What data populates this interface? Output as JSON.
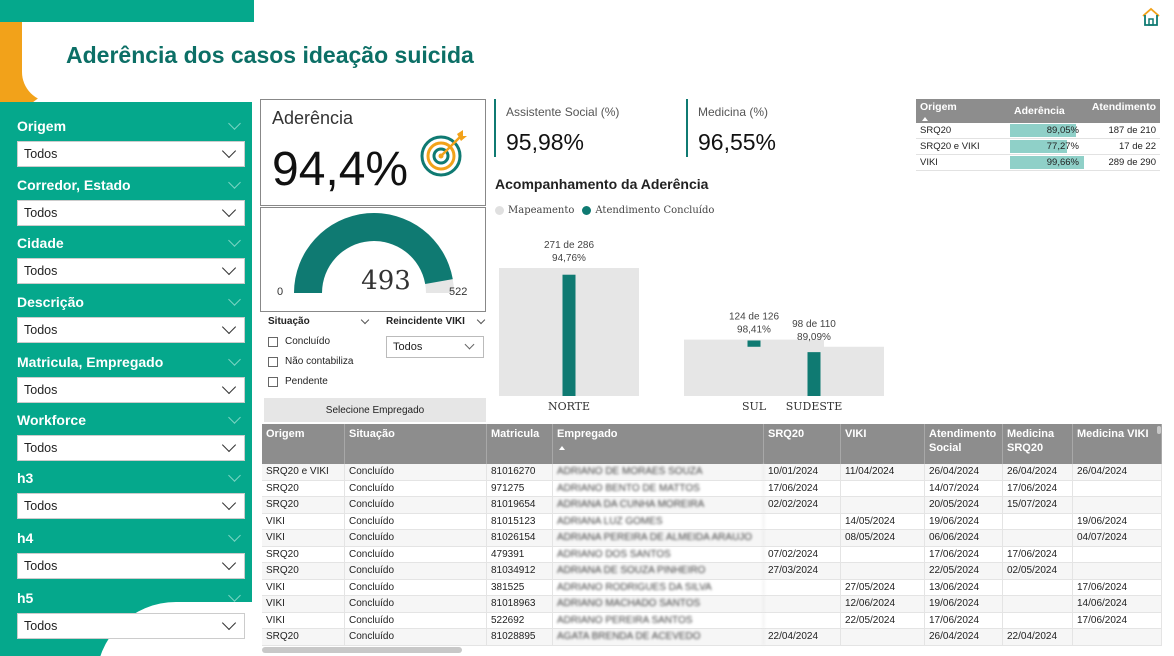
{
  "page": {
    "title": "Aderência dos casos ideação suicida"
  },
  "colors": {
    "teal": "#05a88c",
    "dark_teal": "#0f7a72",
    "orange": "#f2a21a",
    "grey_bar": "#e6e6e6"
  },
  "filters": [
    {
      "label": "Origem",
      "value": "Todos"
    },
    {
      "label": "Corredor, Estado",
      "value": "Todos"
    },
    {
      "label": "Cidade",
      "value": "Todos"
    },
    {
      "label": "Descrição",
      "value": "Todos"
    },
    {
      "label": "Matricula, Empregado",
      "value": "Todos"
    },
    {
      "label": "Workforce",
      "value": "Todos"
    },
    {
      "label": "h3",
      "value": "Todos"
    },
    {
      "label": "h4",
      "value": "Todos"
    },
    {
      "label": "h5",
      "value": "Todos"
    }
  ],
  "kpi_main": {
    "label": "Aderência",
    "value": "94,4%",
    "icon": "target-icon"
  },
  "gauge": {
    "value": "493",
    "min": "0",
    "max": "522",
    "value_num": 493,
    "max_num": 522
  },
  "slicer_situacao": {
    "title": "Situação",
    "options": [
      "Concluído",
      "Não contabiliza",
      "Pendente"
    ]
  },
  "slicer_reincidente": {
    "title": "Reincidente VIKI",
    "value": "Todos"
  },
  "select_employee_label": "Selecione Empregado",
  "kpi_cards": [
    {
      "label": "Assistente Social (%)",
      "value": "95,98%"
    },
    {
      "label": "Medicina (%)",
      "value": "96,55%"
    }
  ],
  "origin_table": {
    "headers": [
      "Origem",
      "Aderência",
      "Atendimento"
    ],
    "rows": [
      {
        "origem": "SRQ20",
        "aderencia": "89,05%",
        "aderencia_num": 0.8905,
        "atendimento": "187 de 210"
      },
      {
        "origem": "SRQ20 e VIKI",
        "aderencia": "77,27%",
        "aderencia_num": 0.7727,
        "atendimento": "17 de 22"
      },
      {
        "origem": "VIKI",
        "aderencia": "99,66%",
        "aderencia_num": 0.9966,
        "atendimento": "289 de 290"
      }
    ]
  },
  "chart_title": "Acompanhamento da Aderência",
  "chart_data": {
    "type": "bar",
    "legend": [
      "Mapeamento",
      "Atendimento Concluído"
    ],
    "categories": [
      "NORTE",
      "SUL",
      "SUDESTE"
    ],
    "series": [
      {
        "name": "Mapeamento",
        "values": [
          286,
          126,
          110
        ]
      },
      {
        "name": "Atendimento Concluído",
        "values": [
          271,
          124,
          98
        ]
      }
    ],
    "labels": [
      {
        "count": "271 de 286",
        "pct": "94,76%"
      },
      {
        "count": "124 de 126",
        "pct": "98,41%"
      },
      {
        "count": "98 de 110",
        "pct": "89,09%"
      }
    ]
  },
  "main_table": {
    "headers": [
      "Origem",
      "Situação",
      "Matricula",
      "Empregado",
      "SRQ20",
      "VIKI",
      "Atendimento Social",
      "Medicina SRQ20",
      "Medicina VIKI"
    ],
    "rows": [
      [
        "SRQ20 e VIKI",
        "Concluído",
        "81016270",
        "ADRIANO DE MORAES SOUZA",
        "10/01/2024",
        "11/04/2024",
        "26/04/2024",
        "26/04/2024",
        "26/04/2024"
      ],
      [
        "SRQ20",
        "Concluído",
        "971275",
        "ADRIANO BENTO DE MATTOS",
        "17/06/2024",
        "",
        "14/07/2024",
        "17/06/2024",
        ""
      ],
      [
        "SRQ20",
        "Concluído",
        "81019654",
        "ADRIANA DA CUNHA MOREIRA",
        "02/02/2024",
        "",
        "20/05/2024",
        "15/07/2024",
        ""
      ],
      [
        "VIKI",
        "Concluído",
        "81015123",
        "ADRIANA LUZ GOMES",
        "",
        "14/05/2024",
        "19/06/2024",
        "",
        "19/06/2024"
      ],
      [
        "VIKI",
        "Concluído",
        "81026154",
        "ADRIANA PEREIRA DE ALMEIDA ARAUJO",
        "",
        "08/05/2024",
        "06/06/2024",
        "",
        "04/07/2024"
      ],
      [
        "SRQ20",
        "Concluído",
        "479391",
        "ADRIANO DOS SANTOS",
        "07/02/2024",
        "",
        "17/06/2024",
        "17/06/2024",
        ""
      ],
      [
        "SRQ20",
        "Concluído",
        "81034912",
        "ADRIANA DE SOUZA PINHEIRO",
        "27/03/2024",
        "",
        "22/05/2024",
        "02/05/2024",
        ""
      ],
      [
        "VIKI",
        "Concluído",
        "381525",
        "ADRIANO RODRIGUES DA SILVA",
        "",
        "27/05/2024",
        "13/06/2024",
        "",
        "17/06/2024"
      ],
      [
        "VIKI",
        "Concluído",
        "81018963",
        "ADRIANO MACHADO SANTOS",
        "",
        "12/06/2024",
        "19/06/2024",
        "",
        "14/06/2024"
      ],
      [
        "VIKI",
        "Concluído",
        "522692",
        "ADRIANO PEREIRA SANTOS",
        "",
        "22/05/2024",
        "17/06/2024",
        "",
        "17/06/2024"
      ],
      [
        "SRQ20",
        "Concluído",
        "81028895",
        "AGATA BRENDA DE ACEVEDO",
        "22/04/2024",
        "",
        "26/04/2024",
        "22/04/2024",
        ""
      ]
    ]
  }
}
